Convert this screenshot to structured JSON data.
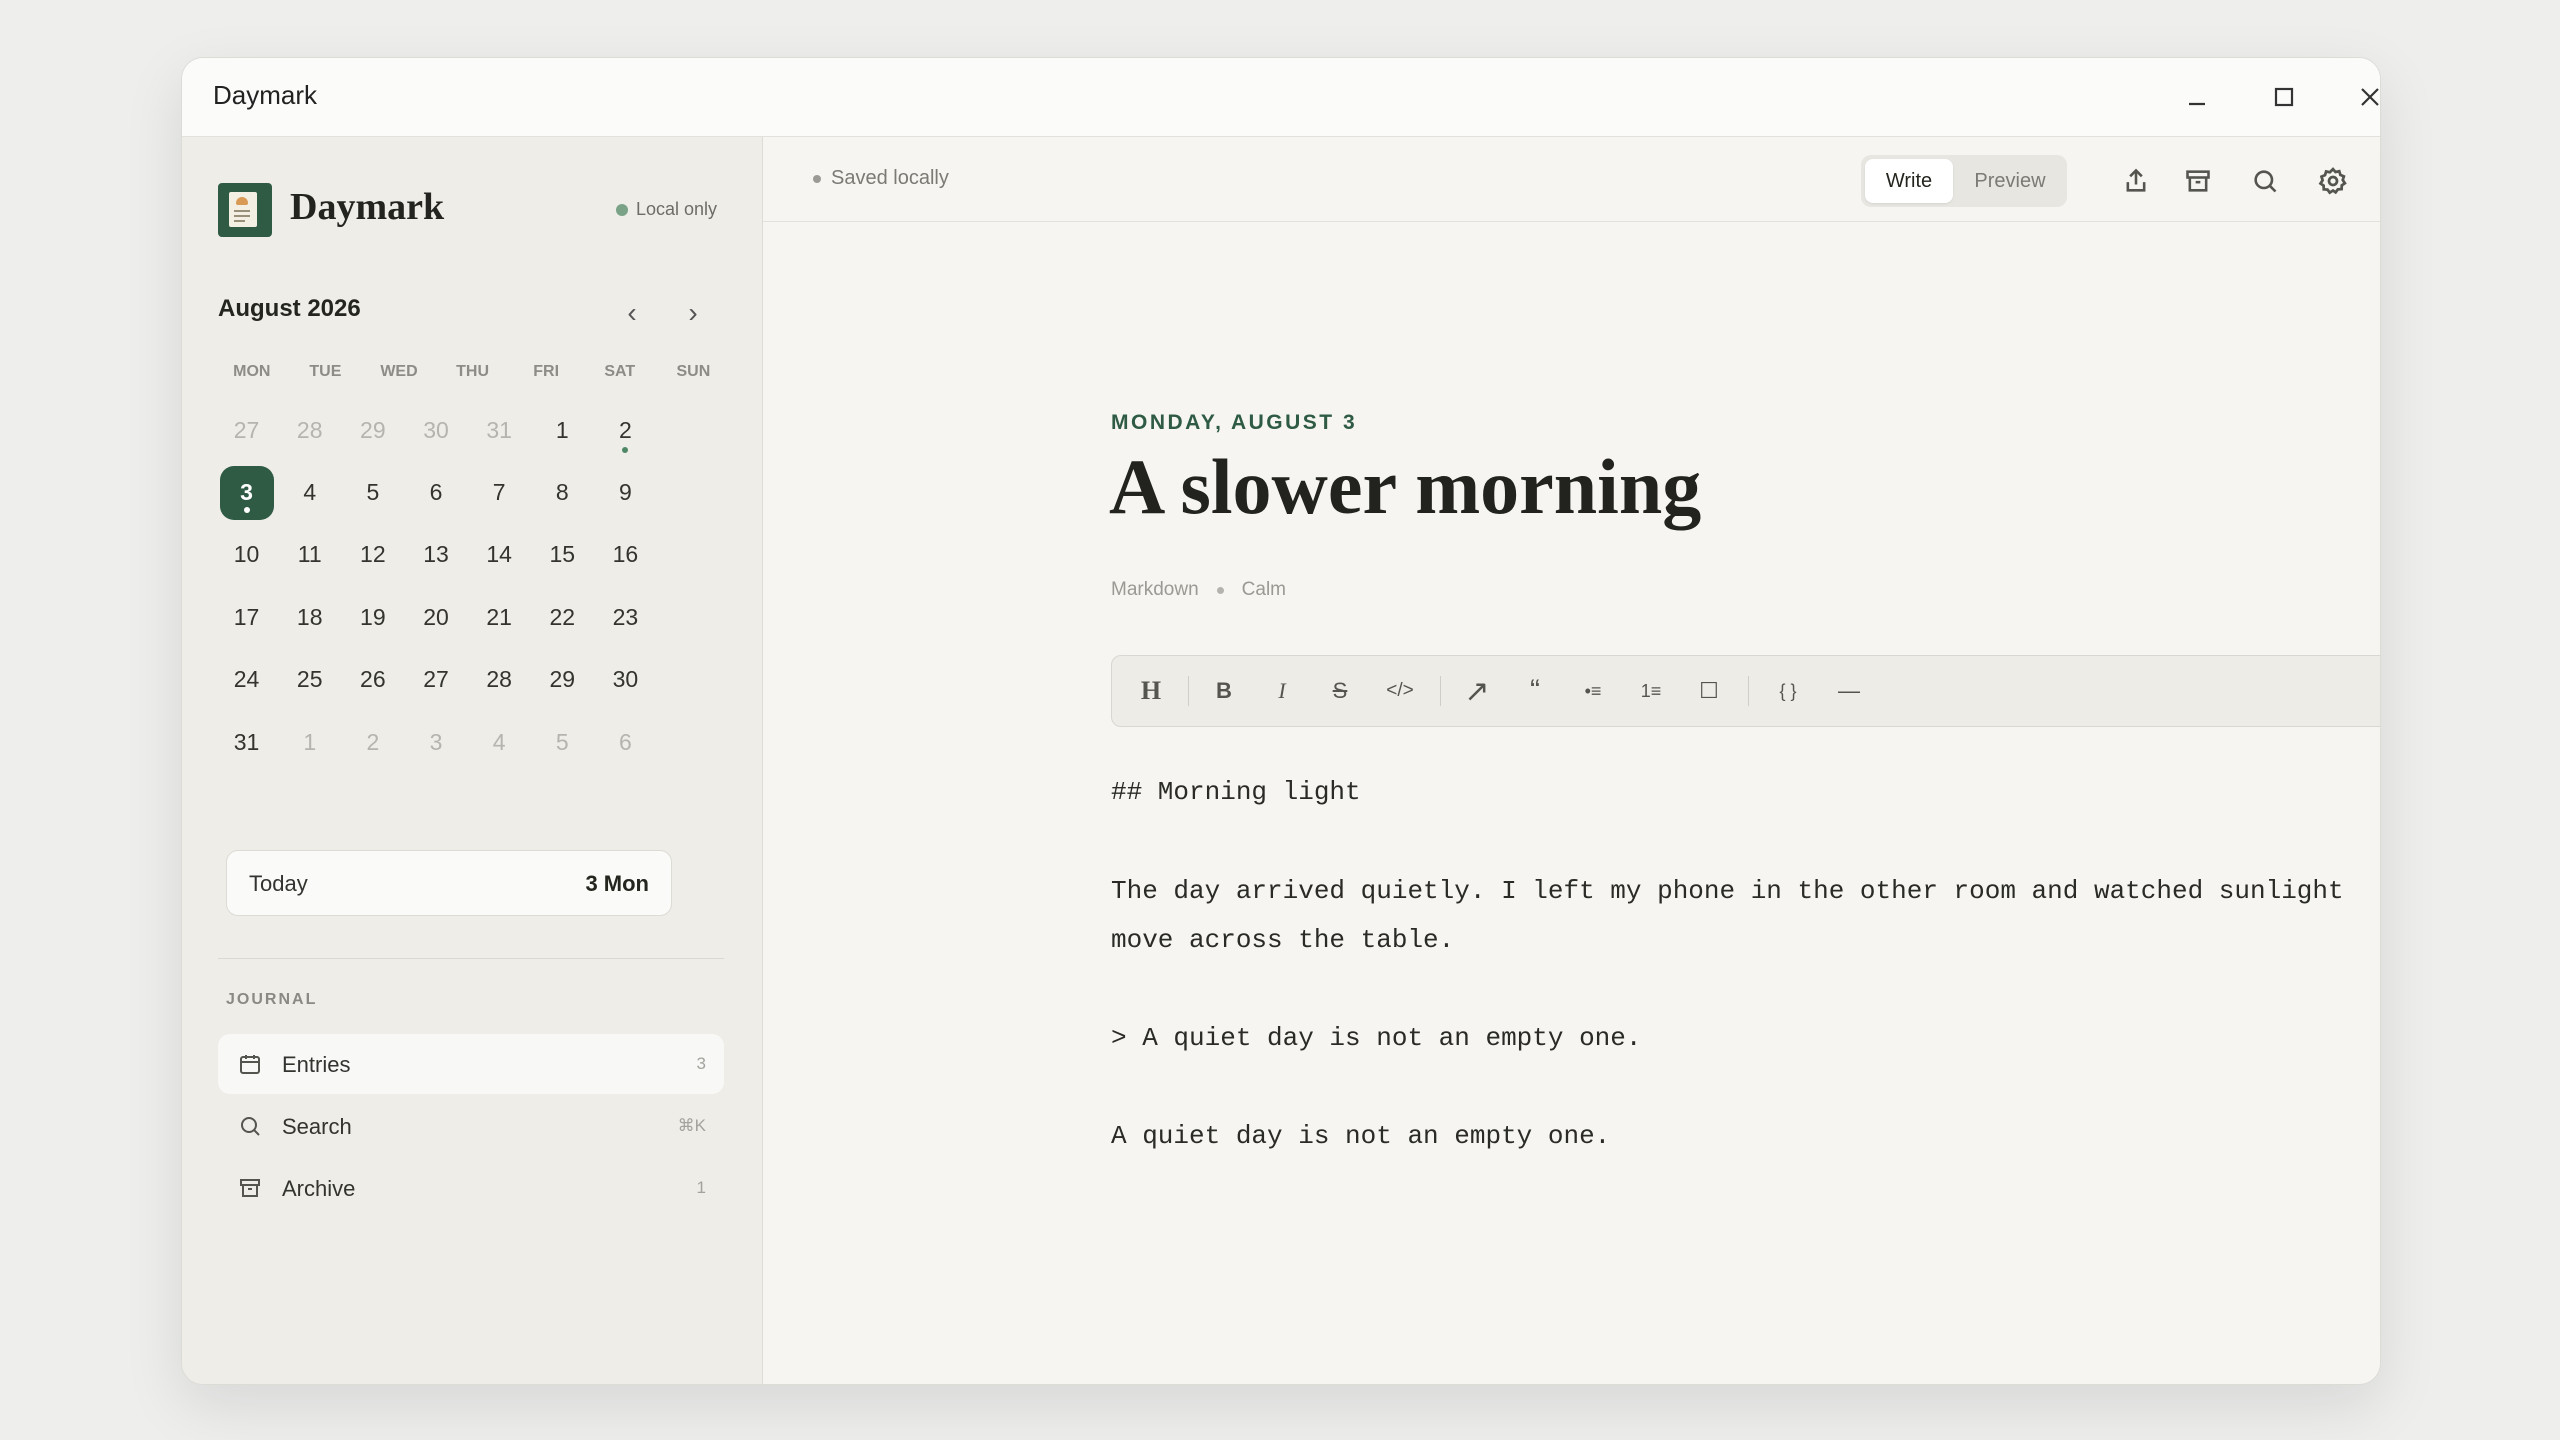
{
  "window": {
    "title": "Daymark"
  },
  "sidebar": {
    "brand": "Daymark",
    "local_status": "Local only",
    "calendar": {
      "month_label": "August 2026",
      "prev": "‹",
      "next": "›",
      "weekdays": [
        "MON",
        "TUE",
        "WED",
        "THU",
        "FRI",
        "SAT",
        "SUN"
      ],
      "weeks": [
        [
          {
            "d": "27",
            "muted": true
          },
          {
            "d": "28",
            "muted": true
          },
          {
            "d": "29",
            "muted": true
          },
          {
            "d": "30",
            "muted": true
          },
          {
            "d": "31",
            "muted": true
          },
          {
            "d": "1"
          },
          {
            "d": "2",
            "mark": true
          }
        ],
        [
          {
            "d": "3",
            "selected": true,
            "mark": true
          },
          {
            "d": "4"
          },
          {
            "d": "5"
          },
          {
            "d": "6"
          },
          {
            "d": "7"
          },
          {
            "d": "8"
          },
          {
            "d": "9"
          }
        ],
        [
          {
            "d": "10"
          },
          {
            "d": "11"
          },
          {
            "d": "12"
          },
          {
            "d": "13"
          },
          {
            "d": "14"
          },
          {
            "d": "15"
          },
          {
            "d": "16"
          }
        ],
        [
          {
            "d": "17"
          },
          {
            "d": "18"
          },
          {
            "d": "19"
          },
          {
            "d": "20"
          },
          {
            "d": "21"
          },
          {
            "d": "22"
          },
          {
            "d": "23"
          }
        ],
        [
          {
            "d": "24"
          },
          {
            "d": "25"
          },
          {
            "d": "26"
          },
          {
            "d": "27"
          },
          {
            "d": "28"
          },
          {
            "d": "29"
          },
          {
            "d": "30"
          }
        ],
        [
          {
            "d": "31"
          },
          {
            "d": "1",
            "muted": true
          },
          {
            "d": "2",
            "muted": true
          },
          {
            "d": "3",
            "muted": true
          },
          {
            "d": "4",
            "muted": true
          },
          {
            "d": "5",
            "muted": true
          },
          {
            "d": "6",
            "muted": true
          }
        ]
      ]
    },
    "today": {
      "label": "Today",
      "value": "3 Mon"
    },
    "section_label": "JOURNAL",
    "nav": [
      {
        "label": "Entries",
        "count": "3",
        "icon": "calendar-icon"
      },
      {
        "label": "Search",
        "count": "⌘K",
        "icon": "search-icon"
      },
      {
        "label": "Archive",
        "count": "1",
        "icon": "archive-icon"
      }
    ]
  },
  "toolbar": {
    "saved_status": "Saved locally",
    "mode_write": "Write",
    "mode_preview": "Preview"
  },
  "entry": {
    "date": "MONDAY, AUGUST 3",
    "title": "A slower morning",
    "format": "Markdown",
    "mood": "Calm",
    "lines": [
      "## Morning light",
      "The day arrived quietly. I left my phone in the other room and watched sunlight",
      "move across the table.",
      "> A quiet day is not an empty one.",
      "A quiet day is not an empty one."
    ]
  },
  "format_bar": {
    "heading": "H",
    "bold": "B",
    "italic": "I",
    "strike": "S",
    "code": "</>",
    "link": "↗",
    "quote": "“",
    "bullet": "•≡",
    "numbered": "1≡",
    "checkbox": "☐",
    "code_block": "{ }",
    "rule": "—"
  },
  "colors": {
    "accent": "#2f5b45",
    "sidebar_bg": "#eeede8",
    "main_bg": "#f6f5f1"
  }
}
